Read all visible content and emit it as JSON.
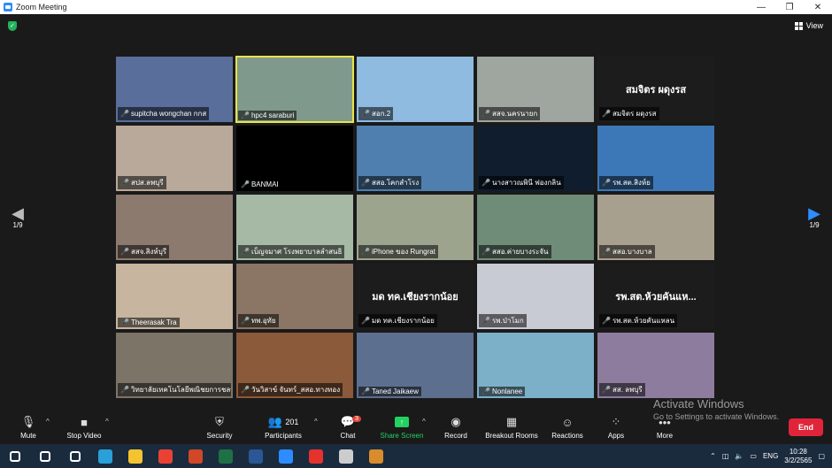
{
  "window": {
    "title": "Zoom Meeting",
    "minimize": "—",
    "restore": "❐",
    "close": "✕"
  },
  "header": {
    "view_label": "View"
  },
  "pager": {
    "left": "1/9",
    "right": "1/9"
  },
  "tiles": [
    {
      "name": "supitcha wongchan กกส",
      "bg": "#5a6e9c",
      "big": "",
      "active": false
    },
    {
      "name": "hpc4 saraburi",
      "bg": "#7f9a8c",
      "big": "",
      "active": true
    },
    {
      "name": "สอก.2",
      "bg": "#8fbbe0",
      "big": "",
      "active": false
    },
    {
      "name": "สสจ.นครนายก",
      "bg": "#9fa6a0",
      "big": "",
      "active": false
    },
    {
      "name": "สมจิตร ผดุงรส",
      "bg": "#1c1c1c",
      "big": "สมจิตร ผดุงรส",
      "active": false
    },
    {
      "name": "สปส.ลพบุรี",
      "bg": "#b9a99a",
      "big": "",
      "active": false
    },
    {
      "name": "BANMAI",
      "bg": "#000000",
      "big": "",
      "active": false
    },
    {
      "name": "สสอ.โคกสำโรง",
      "bg": "#4e7fae",
      "big": "",
      "active": false
    },
    {
      "name": "นางสาวณพินี ฟองกลิน",
      "bg": "#0f1d2e",
      "big": "",
      "active": false
    },
    {
      "name": "รพ.สต.สิงห์ย",
      "bg": "#3c78b8",
      "big": "",
      "active": false
    },
    {
      "name": "สสจ.สิงห์บุรี",
      "bg": "#8d7a6e",
      "big": "",
      "active": false
    },
    {
      "name": "เบ็ญจมาศ โรงพยาบาลลำสนธิ",
      "bg": "#a5b9a5",
      "big": "",
      "active": false
    },
    {
      "name": "iPhone ของ Rungrat",
      "bg": "#9da48e",
      "big": "",
      "active": false
    },
    {
      "name": "สสอ.ค่ายบางระจัน",
      "bg": "#6f8c79",
      "big": "",
      "active": false
    },
    {
      "name": "สสอ.บางบาล",
      "bg": "#a8a08e",
      "big": "",
      "active": false
    },
    {
      "name": "Theerasak Tra",
      "bg": "#c7b5a0",
      "big": "",
      "active": false
    },
    {
      "name": "ทพ.อุทัย",
      "bg": "#8b7564",
      "big": "",
      "active": false
    },
    {
      "name": "มด ทค.เชียงรากน้อย",
      "bg": "#1c1c1c",
      "big": "มด ทค.เชียงรากน้อย",
      "active": false
    },
    {
      "name": "รพ.ป่าโมก",
      "bg": "#c9cbd4",
      "big": "",
      "active": false
    },
    {
      "name": "รพ.สต.ห้วยคันแหลน",
      "bg": "#1c1c1c",
      "big": "รพ.สต.ห้วยคันแห...",
      "active": false
    },
    {
      "name": "วิทยาลัยเทคโนโลยีพณิชยการชลบุ...",
      "bg": "#7d7468",
      "big": "",
      "active": false
    },
    {
      "name": "วันวิสาข์ จันทร์_สสอ.ทางทอง",
      "bg": "#8a5a3a",
      "big": "",
      "active": false
    },
    {
      "name": "Taned Jaikaew",
      "bg": "#5d6f8e",
      "big": "",
      "active": false
    },
    {
      "name": "Nonlanee",
      "bg": "#7cb0c8",
      "big": "",
      "active": false
    },
    {
      "name": "สส. ลพบุรี",
      "bg": "#8e7c9e",
      "big": "",
      "active": false
    }
  ],
  "toolbar": {
    "mute": "Mute",
    "stop_video": "Stop Video",
    "security": "Security",
    "participants": "Participants",
    "participants_count": "201",
    "chat": "Chat",
    "chat_badge": "3",
    "share": "Share Screen",
    "record": "Record",
    "breakout": "Breakout Rooms",
    "reactions": "Reactions",
    "apps": "Apps",
    "more": "More",
    "end": "End"
  },
  "watermark": {
    "line1": "Activate Windows",
    "line2": "Go to Settings to activate Windows."
  },
  "taskbar": {
    "apps": [
      {
        "name": "start-button",
        "color": "#ffffff"
      },
      {
        "name": "search",
        "color": "#ffffff"
      },
      {
        "name": "task-view",
        "color": "#ffffff"
      },
      {
        "name": "edge",
        "color": "#2aa0d8"
      },
      {
        "name": "file-explorer",
        "color": "#f4c430"
      },
      {
        "name": "chrome",
        "color": "#e94235"
      },
      {
        "name": "powerpoint",
        "color": "#d24726"
      },
      {
        "name": "excel",
        "color": "#1e7145"
      },
      {
        "name": "word",
        "color": "#2b5797"
      },
      {
        "name": "zoom",
        "color": "#2d8cff"
      },
      {
        "name": "acrobat",
        "color": "#e5322d"
      },
      {
        "name": "obs",
        "color": "#cccccc"
      },
      {
        "name": "app",
        "color": "#d98c2b"
      }
    ],
    "lang": "ENG",
    "time": "10:28",
    "date": "3/2/2565"
  }
}
